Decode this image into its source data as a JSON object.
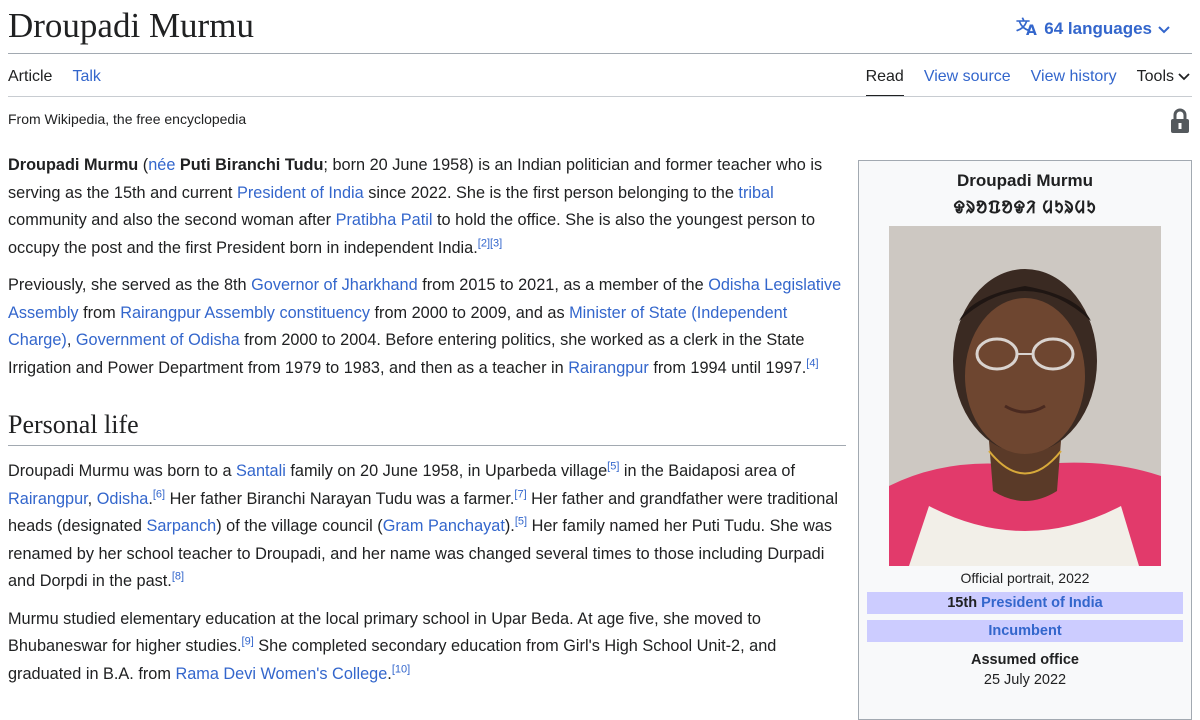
{
  "page": {
    "title": "Droupadi Murmu",
    "languages": "64 languages",
    "tagline": "From Wikipedia, the free encyclopedia"
  },
  "tabs": {
    "article": "Article",
    "talk": "Talk",
    "read": "Read",
    "view_source": "View source",
    "view_history": "View history",
    "tools": "Tools"
  },
  "intro": {
    "p1": {
      "name": "Droupadi Murmu",
      "t1": " (",
      "nee": "née",
      "t2": " ",
      "birth_name": "Puti Biranchi Tudu",
      "t3": "; born 20 June 1958) is an Indian politician and former teacher who is serving as the 15th and current ",
      "l_president": "President of India",
      "t4": " since 2022. She is the first person belonging to the ",
      "l_tribal": "tribal",
      "t5": " community and also the second woman after ",
      "l_patil": "Pratibha Patil",
      "t6": " to hold the office. She is also the youngest person to occupy the post and the first President born in independent India.",
      "ref1": "[2][3]"
    },
    "p2": {
      "t1": "Previously, she served as the 8th ",
      "l_gov": "Governor of Jharkhand",
      "t2": " from 2015 to 2021, as a member of the ",
      "l_ola": "Odisha Legislative Assembly",
      "t3": " from ",
      "l_rac": "Rairangpur Assembly constituency",
      "t4": " from 2000 to 2009, and as ",
      "l_mos": "Minister of State (Independent Charge)",
      "t5": ", ",
      "l_goo": "Government of Odisha",
      "t6": " from 2000 to 2004. Before entering politics, she worked as a clerk in the State Irrigation and Power Department from 1979 to 1983, and then as a teacher in ",
      "l_rair": "Rairangpur",
      "t7": " from 1994 until 1997.",
      "ref": "[4]"
    }
  },
  "personal": {
    "heading": "Personal life",
    "p1": {
      "t1": "Droupadi Murmu was born to a ",
      "l_santali": "Santali",
      "t2": " family on 20 June 1958, in Uparbeda village",
      "ref5a": "[5]",
      "t3": " in the Baidaposi area of ",
      "l_rair": "Rairangpur",
      "t4": ", ",
      "l_odisha": "Odisha",
      "t5": ".",
      "ref6": "[6]",
      "t6": " Her father Biranchi Narayan Tudu was a farmer.",
      "ref7": "[7]",
      "t7": " Her father and grandfather were traditional heads (designated ",
      "l_sarpanch": "Sarpanch",
      "t8": ") of the village council (",
      "l_gram": "Gram Panchayat",
      "t9": ").",
      "ref5b": "[5]",
      "t10": " Her family named her Puti Tudu. She was renamed by her school teacher to Droupadi, and her name was changed several times to those including Durpadi and Dorpdi in the past.",
      "ref8": "[8]"
    },
    "p2": {
      "t1": "Murmu studied elementary education at the local primary school in Upar Beda. At age five, she moved to Bhubaneswar for higher studies.",
      "ref9": "[9]",
      "t2": " She completed secondary education from Girl's High School Unit-2, and graduated in B.A. from ",
      "l_rdwc": "Rama Devi Women's College",
      "t3": ".",
      "ref10": "[10]"
    }
  },
  "infobox": {
    "name": "Droupadi Murmu",
    "native_name": "ᱫᱨᱚᱯᱚᱫᱤ ᱢᱩᱨᱢᱩ",
    "caption": "Official portrait, 2022",
    "office_prefix": "15th ",
    "office_link": "President of India",
    "incumbent": "Incumbent",
    "assumed_label": "Assumed office",
    "assumed_date": "25 July 2022",
    "header_color": "#ccccff"
  }
}
